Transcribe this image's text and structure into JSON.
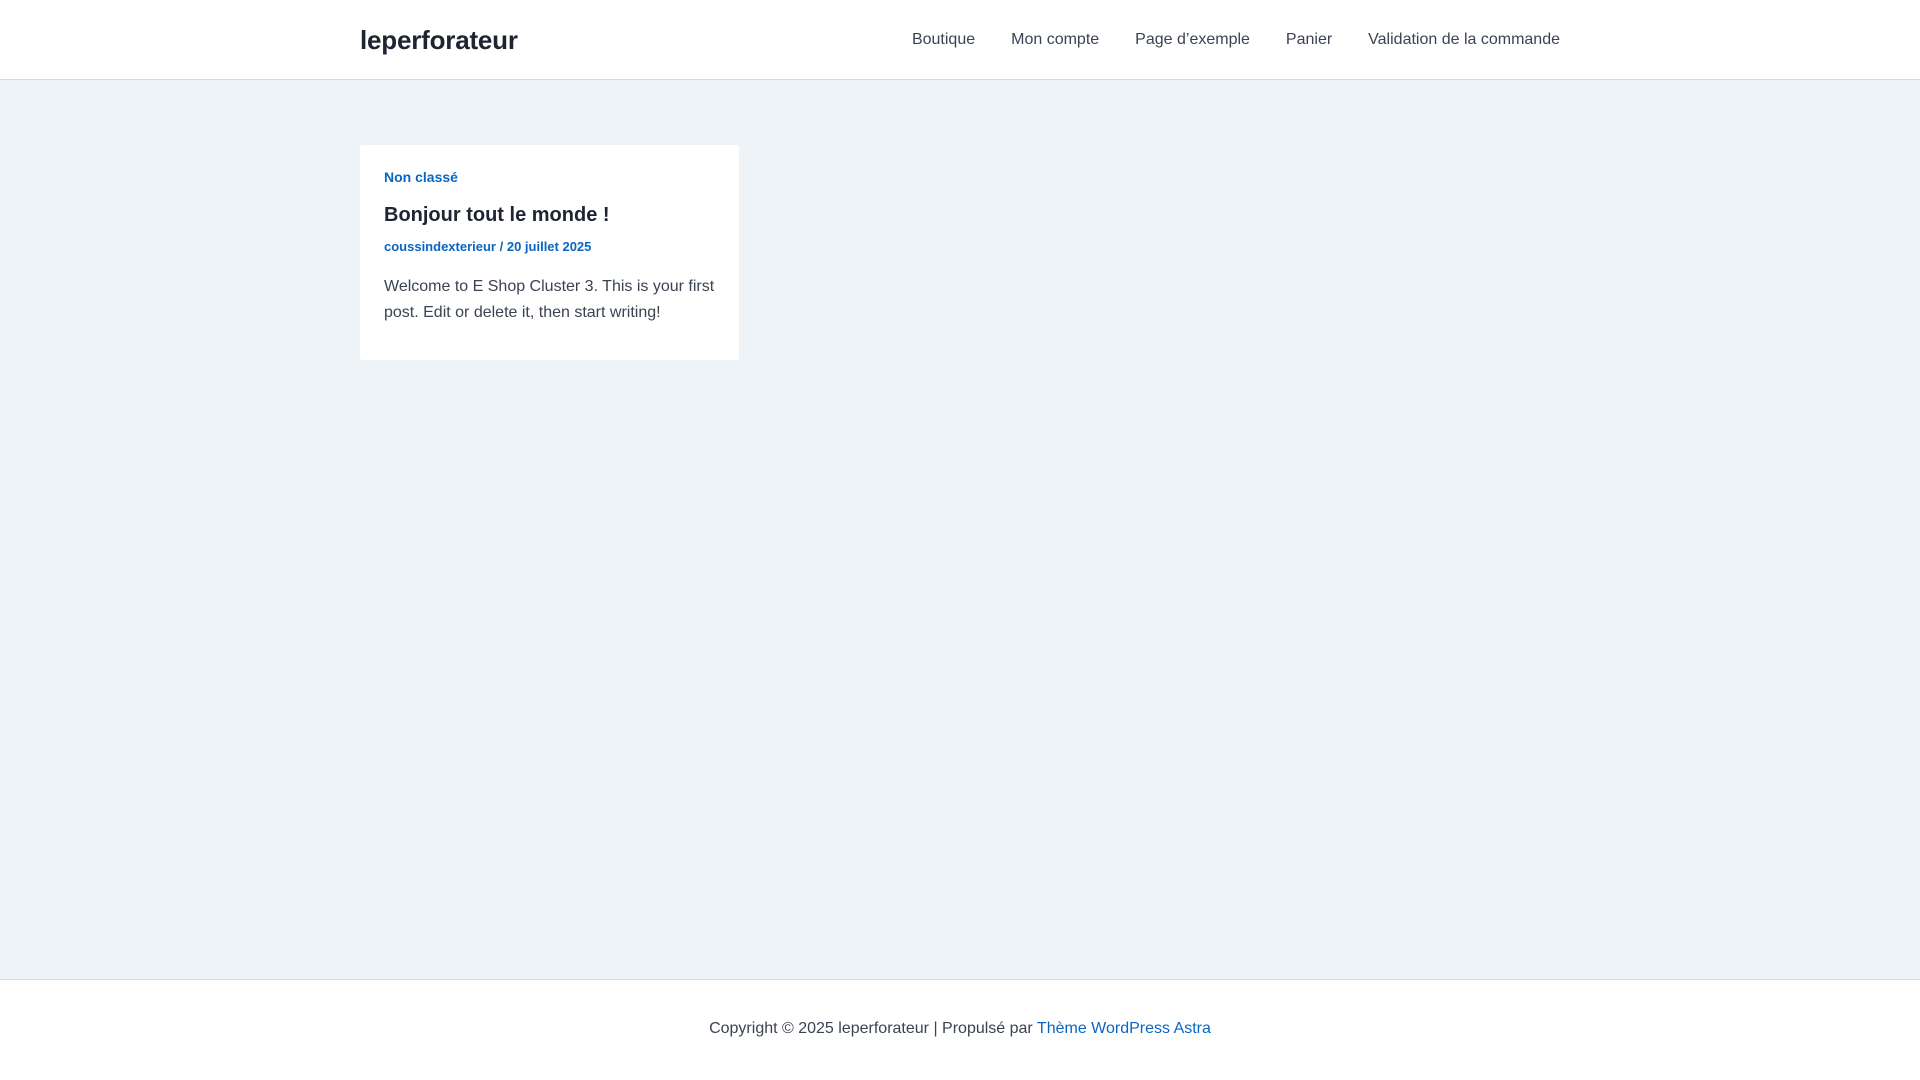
{
  "header": {
    "site_title": "leperforateur",
    "nav": [
      {
        "label": "Boutique"
      },
      {
        "label": "Mon compte"
      },
      {
        "label": "Page d’exemple"
      },
      {
        "label": "Panier"
      },
      {
        "label": "Validation de la commande"
      }
    ]
  },
  "post": {
    "category": "Non classé",
    "title": "Bonjour tout le monde !",
    "author": "coussindexterieur",
    "separator": " / ",
    "date": "20 juillet 2025",
    "excerpt": "Welcome to E Shop Cluster 3. This is your first post. Edit or delete it, then start writing!"
  },
  "footer": {
    "copyright": "Copyright © 2025 leperforateur | Propulsé par ",
    "theme_link": "Thème WordPress Astra"
  },
  "colors": {
    "accent": "#0a66c2",
    "heading": "#1e2531",
    "background": "#eef3f7",
    "surface": "#ffffff"
  }
}
